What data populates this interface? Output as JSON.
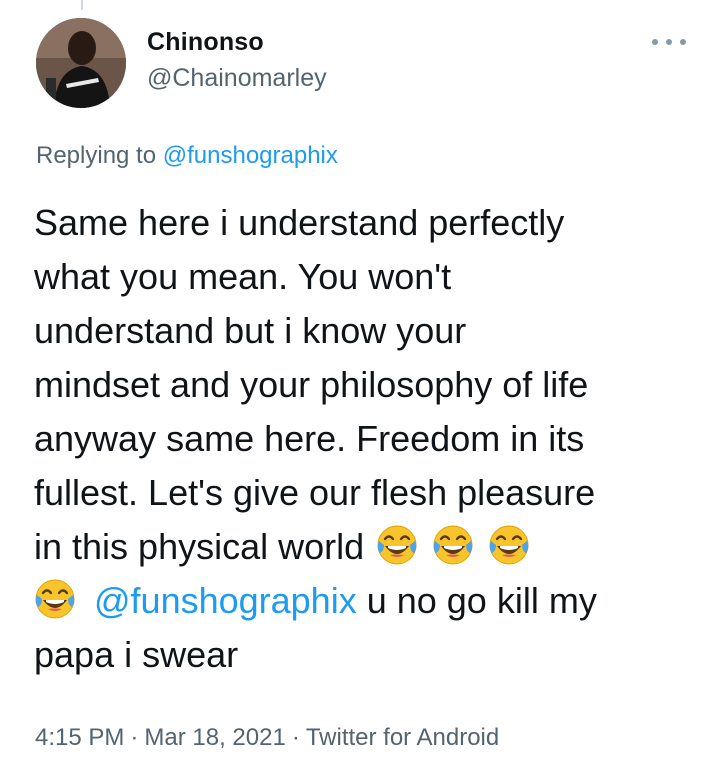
{
  "user": {
    "display_name": "Chinonso",
    "handle": "@Chainomarley",
    "avatar_icon": "profile-photo"
  },
  "more_icon": "more-horizontal-icon",
  "reply_context": {
    "prefix": "Replying to ",
    "mention": "@funshographix"
  },
  "tweet": {
    "line1": "Same here i understand perfectly",
    "line2": "what you mean. You won't",
    "line3": "understand but i know your",
    "line4": "mindset and your philosophy of life",
    "line5": "anyway same here. Freedom in its",
    "line6": "fullest. Let's give our flesh pleasure",
    "line7_text": "in this physical world",
    "line7_emojis": [
      "face-with-tears-of-joy",
      "face-with-tears-of-joy",
      "face-with-tears-of-joy"
    ],
    "line8_emoji": "face-with-tears-of-joy",
    "line8_mention": "@funshographix",
    "line8_text": " u no go kill my",
    "line9": "papa i swear"
  },
  "meta": {
    "time": "4:15 PM",
    "separator": "·",
    "date": "Mar 18, 2021",
    "source": "Twitter for Android"
  },
  "colors": {
    "link": "#1d9bf0",
    "secondary_text": "#536471",
    "primary_text": "#0f1419",
    "emoji_face": "#f7c52b"
  }
}
